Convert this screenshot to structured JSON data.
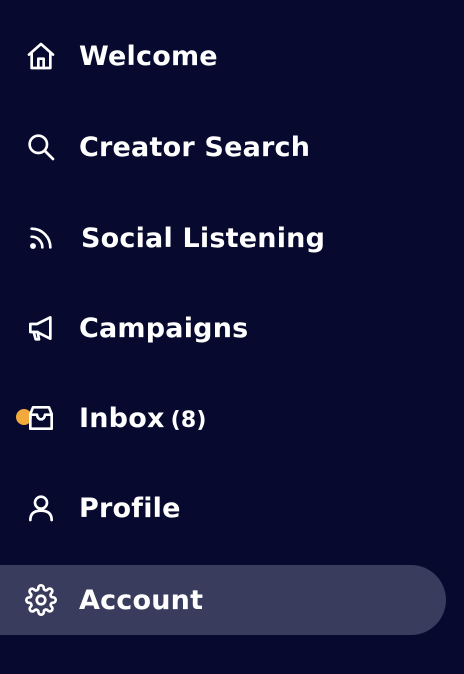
{
  "sidebar": {
    "items": [
      {
        "label": "Welcome",
        "icon": "home-icon"
      },
      {
        "label": "Creator Search",
        "icon": "search-icon"
      },
      {
        "label": "Social Listening",
        "icon": "rss-icon"
      },
      {
        "label": "Campaigns",
        "icon": "megaphone-icon"
      },
      {
        "label": "Inbox",
        "count": "(8)",
        "icon": "inbox-icon",
        "has_notification": true
      },
      {
        "label": "Profile",
        "icon": "user-icon"
      },
      {
        "label": "Account",
        "icon": "gear-icon",
        "active": true
      }
    ]
  },
  "colors": {
    "background": "#070a2e",
    "active_background": "#393c5c",
    "notification_dot": "#f4a93d",
    "text": "#ffffff"
  }
}
